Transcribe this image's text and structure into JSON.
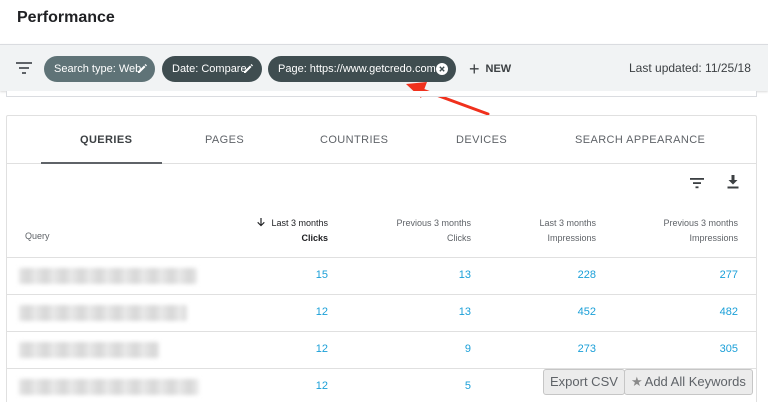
{
  "header": {
    "title": "Performance"
  },
  "filters": {
    "chips": [
      {
        "label": "Search type: Web"
      },
      {
        "label": "Date: Compare"
      },
      {
        "label": "Page: https://www.getcredo.com..."
      }
    ],
    "new_label": "NEW",
    "last_updated": "Last updated: 11/25/18"
  },
  "tabs": [
    {
      "label": "QUERIES",
      "active": true
    },
    {
      "label": "PAGES"
    },
    {
      "label": "COUNTRIES"
    },
    {
      "label": "DEVICES"
    },
    {
      "label": "SEARCH APPEARANCE"
    }
  ],
  "table": {
    "query_header": "Query",
    "columns": [
      {
        "line1": "Last 3 months",
        "line2": "Clicks",
        "sorted": true
      },
      {
        "line1": "Previous 3 months",
        "line2": "Clicks"
      },
      {
        "line1": "Last 3 months",
        "line2": "Impressions"
      },
      {
        "line1": "Previous 3 months",
        "line2": "Impressions"
      }
    ],
    "rows": [
      {
        "values": [
          "15",
          "13",
          "228",
          "277"
        ]
      },
      {
        "values": [
          "12",
          "13",
          "452",
          "482"
        ]
      },
      {
        "values": [
          "12",
          "9",
          "273",
          "305"
        ]
      },
      {
        "values": [
          "12",
          "5",
          "",
          ""
        ]
      }
    ]
  },
  "overlay_buttons": {
    "export": "Export CSV",
    "add_keywords": "Add All Keywords"
  },
  "icons": {
    "filter": "filter-icon",
    "edit": "pencil-icon",
    "close": "close-circle-icon",
    "add": "plus-icon",
    "download": "download-icon",
    "sort": "arrow-down-icon",
    "star": "star-icon",
    "annotation": "red-arrow-icon"
  },
  "colors": {
    "link": "#1a9fd8",
    "chip_light": "#5f7377",
    "chip_dark": "#3f4d50",
    "annotation_arrow": "#f0301c"
  }
}
